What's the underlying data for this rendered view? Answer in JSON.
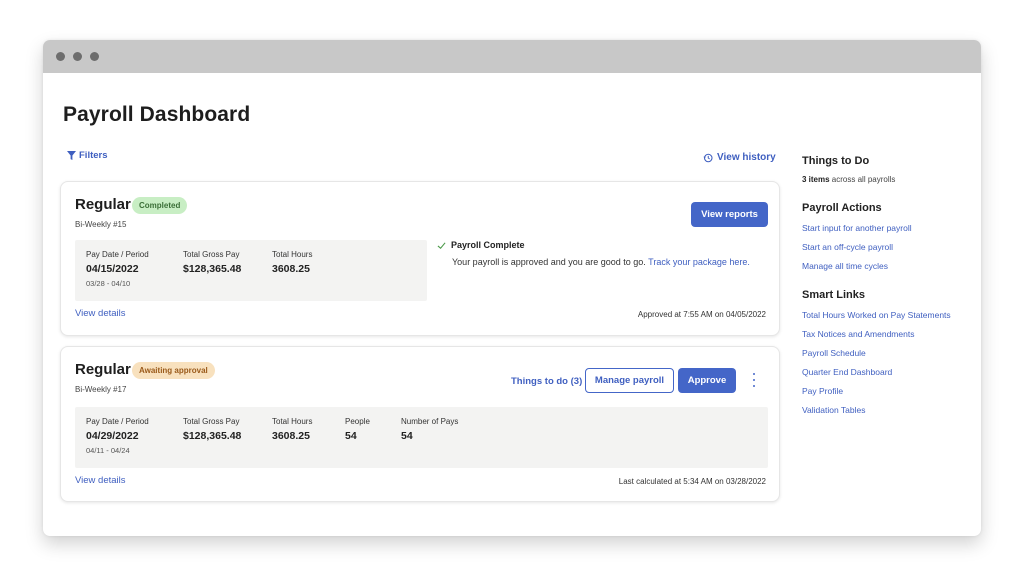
{
  "window": {
    "controls": [
      "close",
      "minimize",
      "maximize"
    ]
  },
  "header": {
    "title": "Payroll Dashboard",
    "filters_label": "Filters",
    "filters_icon": "filter-icon",
    "history_label": "View history",
    "history_icon": "history-icon"
  },
  "payrolls": [
    {
      "type": "Regular",
      "status": "Completed",
      "status_color": "#c8eec4",
      "cycle": "Bi-Weekly #15",
      "stats": [
        {
          "label": "Pay Date / Period",
          "value": "04/15/2022",
          "sub": "03/28 - 04/10"
        },
        {
          "label": "Total Gross Pay",
          "value": "$128,365.48"
        },
        {
          "label": "Total Hours",
          "value": "3608.25"
        }
      ],
      "primary_button": "View reports",
      "message": {
        "icon": "check-icon",
        "title": "Payroll Complete",
        "text": "Your payroll is approved and you are good to go. ",
        "link": "Track your package here."
      },
      "view_details": "View details",
      "footnote": "Approved at 7:55 AM on 04/05/2022"
    },
    {
      "type": "Regular",
      "status": "Awaiting approval",
      "status_color": "#f8e1be",
      "cycle": "Bi-Weekly #17",
      "stats": [
        {
          "label": "Pay Date / Period",
          "value": "04/29/2022",
          "sub": "04/11 - 04/24"
        },
        {
          "label": "Total Gross Pay",
          "value": "$128,365.48"
        },
        {
          "label": "Total Hours",
          "value": "3608.25"
        },
        {
          "label": "People",
          "value": "54"
        },
        {
          "label": "Number of Pays",
          "value": "54"
        }
      ],
      "things_to_do_link": "Things to do (3)",
      "secondary_button": "Manage payroll",
      "primary_button": "Approve",
      "more_icon": "more-vertical-icon",
      "view_details": "View details",
      "footnote": "Last calculated at 5:34 AM on 03/28/2022"
    }
  ],
  "sidebar": {
    "things_to_do": {
      "title": "Things to Do",
      "count": "3 items",
      "count_suffix": " across all payrolls"
    },
    "payroll_actions": {
      "title": "Payroll Actions",
      "items": [
        "Start input for another payroll",
        "Start an off-cycle payroll",
        "Manage all time cycles"
      ]
    },
    "smart_links": {
      "title": "Smart Links",
      "items": [
        "Total Hours Worked on Pay Statements",
        "Tax Notices and Amendments",
        "Payroll Schedule",
        "Quarter End Dashboard",
        "Pay Profile",
        "Validation Tables"
      ]
    }
  },
  "colors": {
    "accent": "#4466c8",
    "link": "#3f5fc0",
    "titlebar": "#c8c8c8",
    "stats_bg": "#f3f3f2"
  }
}
